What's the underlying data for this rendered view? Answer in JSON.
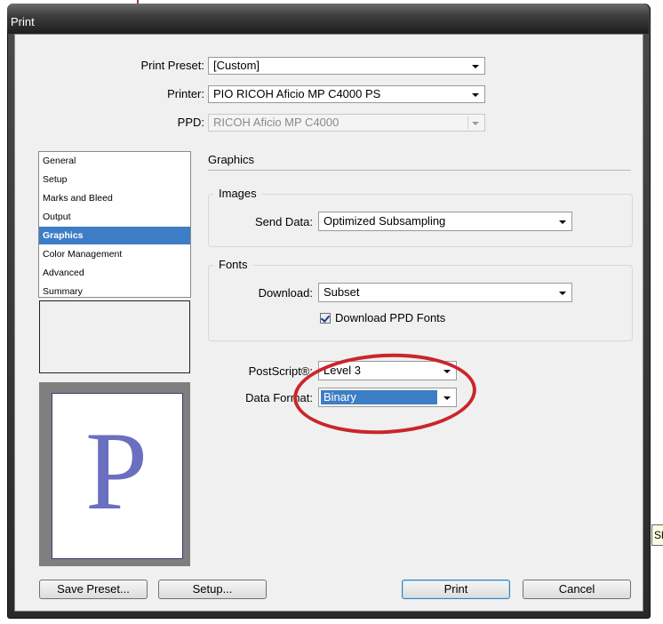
{
  "window": {
    "title": "Print"
  },
  "top_fields": {
    "preset_label": "Print Preset:",
    "preset_value": "[Custom]",
    "printer_label": "Printer:",
    "printer_value": "PIO RICOH Aficio MP C4000 PS",
    "ppd_label": "PPD:",
    "ppd_value": "RICOH Aficio MP C4000"
  },
  "categories": [
    {
      "label": "General"
    },
    {
      "label": "Setup"
    },
    {
      "label": "Marks and Bleed"
    },
    {
      "label": "Output"
    },
    {
      "label": "Graphics",
      "selected": true
    },
    {
      "label": "Color Management"
    },
    {
      "label": "Advanced"
    },
    {
      "label": "Summary"
    }
  ],
  "preview": {
    "letter": "P"
  },
  "graphics": {
    "heading": "Graphics",
    "images": {
      "label": "Images",
      "send_data_label": "Send Data:",
      "send_data_value": "Optimized Subsampling"
    },
    "fonts": {
      "label": "Fonts",
      "download_label": "Download:",
      "download_value": "Subset",
      "download_ppd_label": "Download PPD Fonts",
      "download_ppd_checked": true
    },
    "postscript_label": "PostScript®:",
    "postscript_value": "Level 3",
    "data_format_label": "Data Format:",
    "data_format_value": "Binary"
  },
  "buttons": {
    "save_preset": "Save Preset...",
    "setup": "Setup...",
    "print": "Print",
    "cancel": "Cancel"
  },
  "tooltip": {
    "text": "Sh"
  },
  "colors": {
    "selection": "#3d7dc5",
    "annotation_ellipse": "#c9262c",
    "preview_letter": "#6b6fbf"
  }
}
